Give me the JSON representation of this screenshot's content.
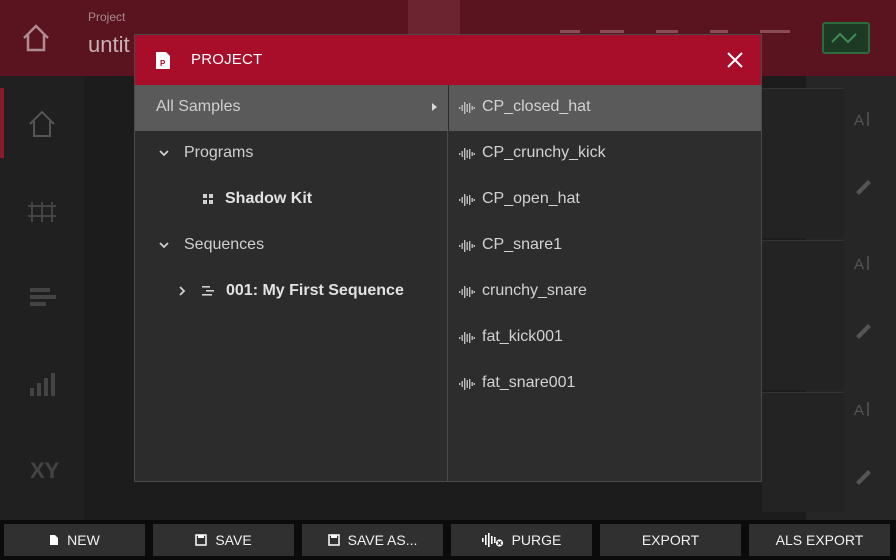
{
  "background": {
    "project_small_label": "Project",
    "project_name": "untit"
  },
  "modal": {
    "title": "PROJECT",
    "header_icon": "project-file-icon",
    "close_icon": "close-icon",
    "tree": [
      {
        "label": "All Samples",
        "selected": true,
        "icon": "chevron-right-icon"
      },
      {
        "label": "Programs",
        "icon": "chevron-down-icon"
      },
      {
        "label": "Shadow Kit",
        "icon": "drum-grid-icon"
      },
      {
        "label": "Sequences",
        "icon": "chevron-down-icon"
      },
      {
        "label": "001: My First Sequence",
        "icon": "sequence-icon"
      }
    ],
    "samples": [
      {
        "label": "CP_closed_hat",
        "selected": true
      },
      {
        "label": "CP_crunchy_kick"
      },
      {
        "label": "CP_open_hat"
      },
      {
        "label": "CP_snare1"
      },
      {
        "label": "crunchy_snare"
      },
      {
        "label": "fat_kick001"
      },
      {
        "label": "fat_snare001"
      }
    ]
  },
  "toolbar": {
    "new_label": "NEW",
    "save_label": "SAVE",
    "save_as_label": "SAVE AS...",
    "purge_label": "PURGE",
    "export_label": "EXPORT",
    "als_export_label": "ALS EXPORT"
  },
  "colors": {
    "header_red": "#a80e2a",
    "selected_row": "#5a5a5a",
    "toolbar_button": "#303030"
  }
}
